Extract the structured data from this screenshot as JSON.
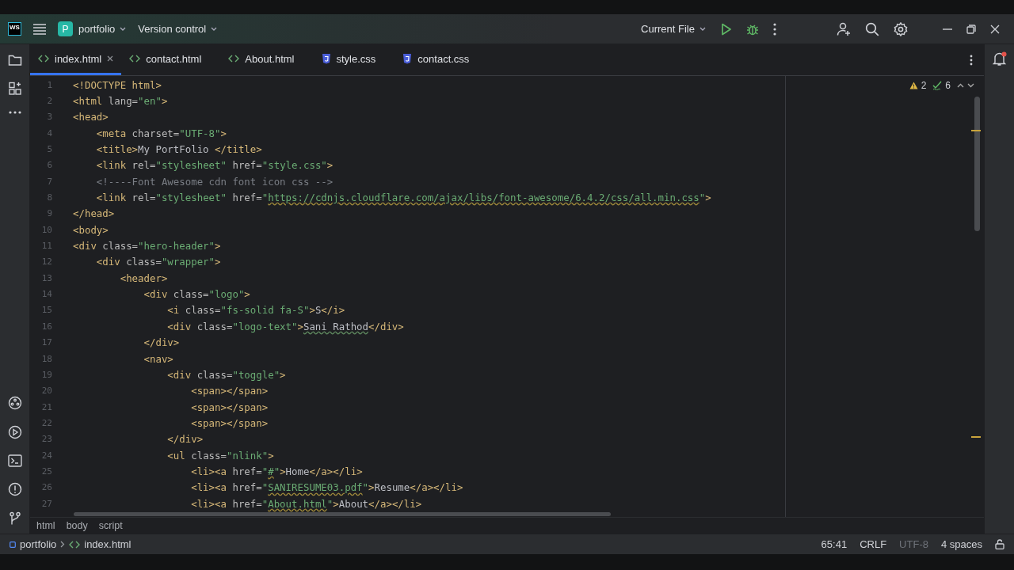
{
  "title_bar": {
    "logo": "WS",
    "project": {
      "badge": "P",
      "name": "portfolio"
    },
    "vcs": "Version control",
    "run_config": "Current File"
  },
  "tabs": [
    {
      "label": "index.html",
      "kind": "html",
      "selected": true
    },
    {
      "label": "contact.html",
      "kind": "html",
      "selected": false
    },
    {
      "label": "About.html",
      "kind": "html",
      "selected": false
    },
    {
      "label": "style.css",
      "kind": "css",
      "selected": false
    },
    {
      "label": "contact.css",
      "kind": "css",
      "selected": false
    }
  ],
  "inspections": {
    "warnings": "2",
    "passed": "6"
  },
  "code_lines": [
    {
      "number": "1",
      "tokens": [
        {
          "kind": "tag",
          "text": "<!DOCTYPE html>"
        }
      ]
    },
    {
      "number": "2",
      "tokens": [
        {
          "kind": "tag",
          "text": "<html"
        },
        {
          "kind": "attr",
          "text": " lang="
        },
        {
          "kind": "str",
          "text": "\"en\""
        },
        {
          "kind": "tag",
          "text": ">"
        }
      ]
    },
    {
      "number": "3",
      "tokens": [
        {
          "kind": "tag",
          "text": "<head>"
        }
      ]
    },
    {
      "number": "4",
      "tokens": [
        {
          "kind": "tag",
          "text": "    <meta"
        },
        {
          "kind": "attr",
          "text": " charset="
        },
        {
          "kind": "str",
          "text": "\"UTF-8\""
        },
        {
          "kind": "tag",
          "text": ">"
        }
      ]
    },
    {
      "number": "5",
      "tokens": [
        {
          "kind": "tag",
          "text": "    <title>"
        },
        {
          "kind": "plain",
          "text": "My PortFolio "
        },
        {
          "kind": "tag",
          "text": "</title>"
        }
      ]
    },
    {
      "number": "6",
      "tokens": [
        {
          "kind": "tag",
          "text": "    <link"
        },
        {
          "kind": "attr",
          "text": " rel="
        },
        {
          "kind": "str",
          "text": "\"stylesheet\""
        },
        {
          "kind": "attr",
          "text": " href="
        },
        {
          "kind": "str",
          "text": "\"style.css\""
        },
        {
          "kind": "tag",
          "text": ">"
        }
      ]
    },
    {
      "number": "7",
      "tokens": [
        {
          "kind": "comment",
          "text": "    <!----Font Awesome cdn font icon css -->"
        }
      ]
    },
    {
      "number": "8",
      "tokens": [
        {
          "kind": "tag",
          "text": "    <link"
        },
        {
          "kind": "attr",
          "text": " rel="
        },
        {
          "kind": "str",
          "text": "\"stylesheet\""
        },
        {
          "kind": "attr",
          "text": " href="
        },
        {
          "kind": "str",
          "text": "\""
        },
        {
          "kind": "url",
          "text": "https://cdnjs.cloudflare.com/ajax/libs/font-awesome/6.4.2/css/all.min.css"
        },
        {
          "kind": "str",
          "text": "\""
        },
        {
          "kind": "tag",
          "text": ">"
        }
      ]
    },
    {
      "number": "9",
      "tokens": [
        {
          "kind": "tag",
          "text": "</head>"
        }
      ]
    },
    {
      "number": "10",
      "tokens": [
        {
          "kind": "tag",
          "text": "<body>"
        }
      ]
    },
    {
      "number": "11",
      "tokens": [
        {
          "kind": "tag",
          "text": "<div"
        },
        {
          "kind": "attr",
          "text": " class="
        },
        {
          "kind": "str",
          "text": "\"hero-header\""
        },
        {
          "kind": "tag",
          "text": ">"
        }
      ]
    },
    {
      "number": "12",
      "tokens": [
        {
          "kind": "tag",
          "text": "    <div"
        },
        {
          "kind": "attr",
          "text": " class="
        },
        {
          "kind": "str",
          "text": "\"wrapper\""
        },
        {
          "kind": "tag",
          "text": ">"
        }
      ]
    },
    {
      "number": "13",
      "tokens": [
        {
          "kind": "tag",
          "text": "        <header>"
        }
      ]
    },
    {
      "number": "14",
      "tokens": [
        {
          "kind": "tag",
          "text": "            <div"
        },
        {
          "kind": "attr",
          "text": " class="
        },
        {
          "kind": "str",
          "text": "\"logo\""
        },
        {
          "kind": "tag",
          "text": ">"
        }
      ]
    },
    {
      "number": "15",
      "tokens": [
        {
          "kind": "tag",
          "text": "                <i"
        },
        {
          "kind": "attr",
          "text": " class="
        },
        {
          "kind": "str",
          "text": "\"fs-solid fa-S\""
        },
        {
          "kind": "tag",
          "text": ">"
        },
        {
          "kind": "plain",
          "text": "S"
        },
        {
          "kind": "tag",
          "text": "</i>"
        }
      ]
    },
    {
      "number": "16",
      "tokens": [
        {
          "kind": "tag",
          "text": "                <div"
        },
        {
          "kind": "attr",
          "text": " class="
        },
        {
          "kind": "str",
          "text": "\"logo-text\""
        },
        {
          "kind": "tag",
          "text": ">"
        },
        {
          "kind": "typo",
          "text": "Sani Rathod"
        },
        {
          "kind": "tag",
          "text": "</div>"
        }
      ]
    },
    {
      "number": "17",
      "tokens": [
        {
          "kind": "tag",
          "text": "            </div>"
        }
      ]
    },
    {
      "number": "18",
      "tokens": [
        {
          "kind": "tag",
          "text": "            <nav>"
        }
      ]
    },
    {
      "number": "19",
      "tokens": [
        {
          "kind": "tag",
          "text": "                <div"
        },
        {
          "kind": "attr",
          "text": " class="
        },
        {
          "kind": "str",
          "text": "\"toggle\""
        },
        {
          "kind": "tag",
          "text": ">"
        }
      ]
    },
    {
      "number": "20",
      "tokens": [
        {
          "kind": "tag",
          "text": "                    <span></span>"
        }
      ]
    },
    {
      "number": "21",
      "tokens": [
        {
          "kind": "tag",
          "text": "                    <span></span>"
        }
      ]
    },
    {
      "number": "22",
      "tokens": [
        {
          "kind": "tag",
          "text": "                    <span></span>"
        }
      ]
    },
    {
      "number": "23",
      "tokens": [
        {
          "kind": "tag",
          "text": "                </div>"
        }
      ]
    },
    {
      "number": "24",
      "tokens": [
        {
          "kind": "tag",
          "text": "                <ul"
        },
        {
          "kind": "attr",
          "text": " class="
        },
        {
          "kind": "str",
          "text": "\"nlink\""
        },
        {
          "kind": "tag",
          "text": ">"
        }
      ]
    },
    {
      "number": "25",
      "tokens": [
        {
          "kind": "tag",
          "text": "                    <li><a"
        },
        {
          "kind": "attr",
          "text": " href="
        },
        {
          "kind": "str",
          "text": "\""
        },
        {
          "kind": "url",
          "text": "#"
        },
        {
          "kind": "str",
          "text": "\""
        },
        {
          "kind": "tag",
          "text": ">"
        },
        {
          "kind": "plain",
          "text": "Home"
        },
        {
          "kind": "tag",
          "text": "</a></li>"
        }
      ]
    },
    {
      "number": "26",
      "tokens": [
        {
          "kind": "tag",
          "text": "                    <li><a"
        },
        {
          "kind": "attr",
          "text": " href="
        },
        {
          "kind": "str",
          "text": "\""
        },
        {
          "kind": "url",
          "text": "SANIRESUME03.pdf"
        },
        {
          "kind": "str",
          "text": "\""
        },
        {
          "kind": "tag",
          "text": ">"
        },
        {
          "kind": "plain",
          "text": "Resume"
        },
        {
          "kind": "tag",
          "text": "</a></li>"
        }
      ]
    },
    {
      "number": "27",
      "tokens": [
        {
          "kind": "tag",
          "text": "                    <li><a"
        },
        {
          "kind": "attr",
          "text": " href="
        },
        {
          "kind": "str",
          "text": "\""
        },
        {
          "kind": "url",
          "text": "About.html"
        },
        {
          "kind": "str",
          "text": "\""
        },
        {
          "kind": "tag",
          "text": ">"
        },
        {
          "kind": "plain",
          "text": "About"
        },
        {
          "kind": "tag",
          "text": "</a></li>"
        }
      ]
    }
  ],
  "breadcrumbs": [
    "html",
    "body",
    "script"
  ],
  "status_bar": {
    "path": [
      "portfolio",
      "index.html"
    ],
    "position": "65:41",
    "line_ending": "CRLF",
    "encoding": "UTF-8",
    "indent": "4 spaces"
  }
}
